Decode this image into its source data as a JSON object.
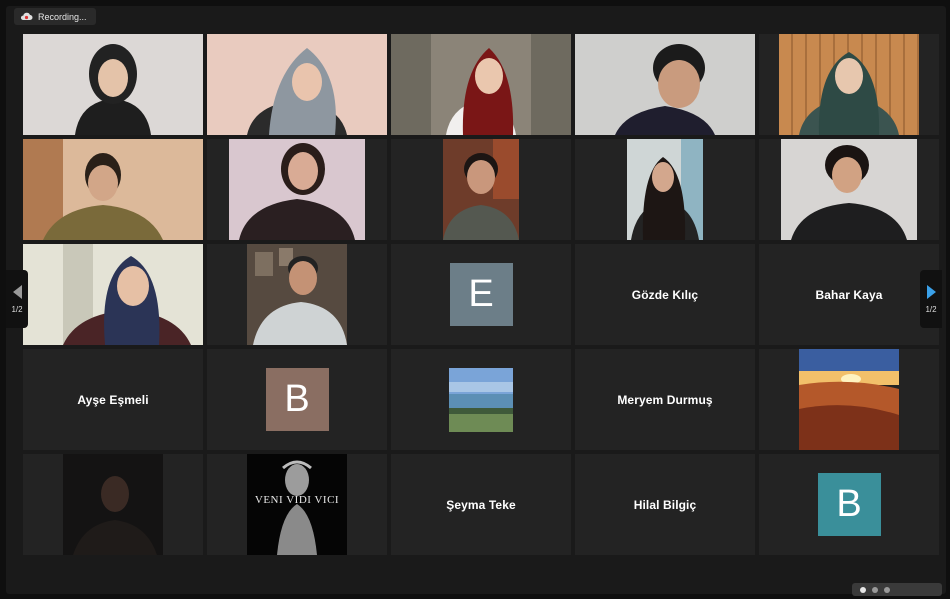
{
  "recording": {
    "label": "Recording...",
    "icon": "cloud-record-icon"
  },
  "pager": {
    "left_label": "1/2",
    "right_label": "1/2"
  },
  "colors": {
    "active_speaker_border": "#c9d45c",
    "avatar_e": "#6c7e88",
    "avatar_b_brown": "#8a6e62",
    "avatar_b_teal": "#3a8f9a",
    "next_arrow": "#3aa0e8"
  },
  "participants": [
    {
      "kind": "video"
    },
    {
      "kind": "video"
    },
    {
      "kind": "video"
    },
    {
      "kind": "video",
      "active": true
    },
    {
      "kind": "video"
    },
    {
      "kind": "video"
    },
    {
      "kind": "video"
    },
    {
      "kind": "video"
    },
    {
      "kind": "video"
    },
    {
      "kind": "video"
    },
    {
      "kind": "video"
    },
    {
      "kind": "video"
    },
    {
      "kind": "avatar",
      "letter": "E"
    },
    {
      "kind": "name",
      "name": "Gözde Kılıç"
    },
    {
      "kind": "name",
      "name": "Bahar Kaya"
    },
    {
      "kind": "name",
      "name": "Ayşe Eşmeli"
    },
    {
      "kind": "avatar",
      "letter": "B"
    },
    {
      "kind": "picture",
      "subject": "lake-landscape"
    },
    {
      "kind": "name",
      "name": "Meryem Durmuş"
    },
    {
      "kind": "picture",
      "subject": "desert-sunset"
    },
    {
      "kind": "video"
    },
    {
      "kind": "picture",
      "subject": "statue",
      "caption": "VENI VIDI VICI"
    },
    {
      "kind": "name",
      "name": "Şeyma Teke"
    },
    {
      "kind": "name",
      "name": "Hilal Bilgiç"
    },
    {
      "kind": "avatar",
      "letter": "B"
    }
  ]
}
